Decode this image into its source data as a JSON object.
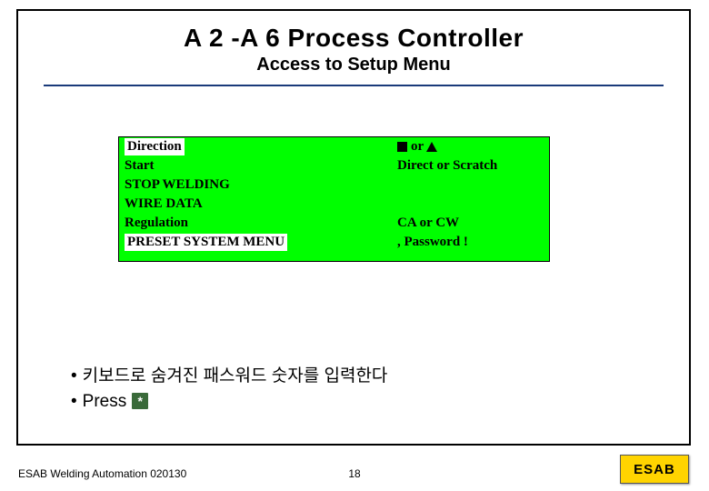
{
  "title": "A 2 -A 6 Process Controller",
  "subtitle": "Access to Setup Menu",
  "screen": {
    "rows": [
      {
        "left": "Direction",
        "left_highlight": true,
        "right_mode": "symbols",
        "right_text": "or"
      },
      {
        "left": "Start",
        "left_highlight": false,
        "right_mode": "text",
        "right_text": "Direct or Scratch"
      },
      {
        "left": "STOP WELDING",
        "left_highlight": false,
        "right_mode": "none",
        "right_text": ""
      },
      {
        "left": "WIRE DATA",
        "left_highlight": false,
        "right_mode": "none",
        "right_text": ""
      },
      {
        "left": "Regulation",
        "left_highlight": false,
        "right_mode": "text",
        "right_text": "CA or CW"
      },
      {
        "left": "PRESET SYSTEM MENU",
        "left_highlight": true,
        "right_mode": "text",
        "right_text": ", Password !"
      }
    ]
  },
  "bullets": {
    "b1": "키보드로 숨겨진 패스워드 숫자를 입력한다",
    "b2": "Press",
    "key_symbol": "*"
  },
  "footer": {
    "left": "ESAB Welding Automation 020130",
    "page": "18"
  },
  "logo_text": "ESAB"
}
